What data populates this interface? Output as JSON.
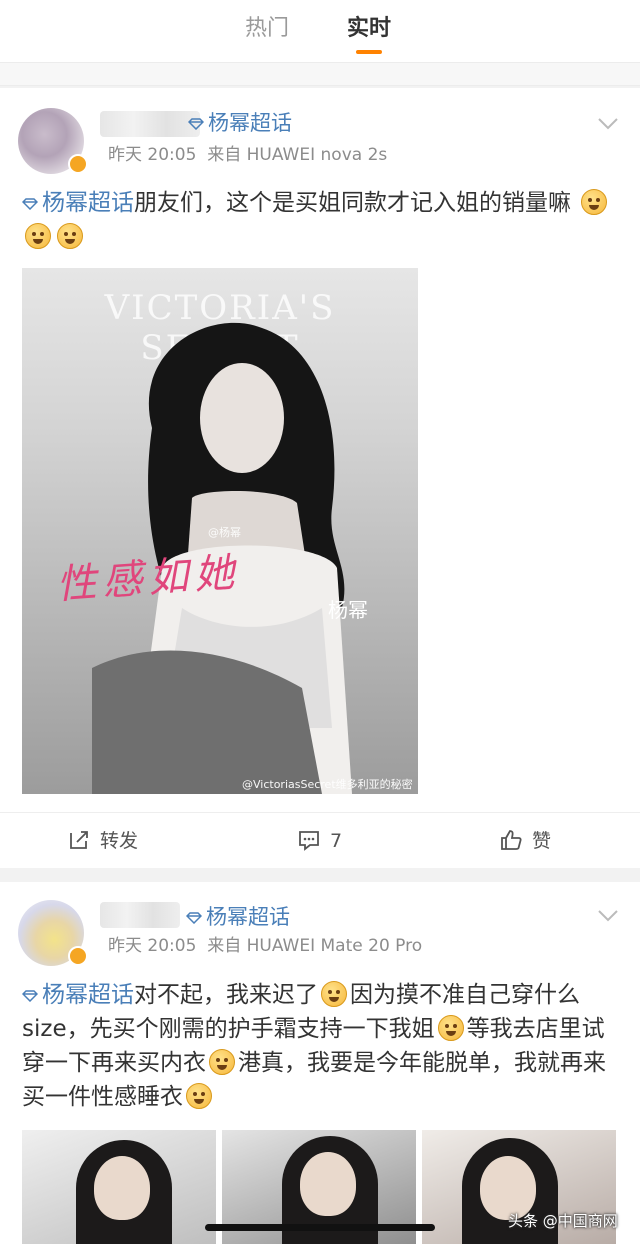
{
  "tabs": {
    "hot": "热门",
    "live": "实时",
    "active": "live"
  },
  "colors": {
    "accent": "#ff8200",
    "link": "#4a7fb8",
    "meta": "#8c8c8c",
    "signature": "#e0467c"
  },
  "posts": [
    {
      "topic_header": "杨幂超话",
      "time": "昨天 20:05",
      "source": "来自 HUAWEI nova 2s",
      "topic_inline": "杨幂超话",
      "text": "朋友们，这个是买姐同款才记入姐的销量嘛",
      "emoji": [
        "dizzy-face",
        "dizzy-face",
        "dizzy-face"
      ],
      "image": {
        "brand": "VICTORIA'S SECRET",
        "signature": "性感如她",
        "name": "杨幂",
        "watermark_top": "@杨幂",
        "watermark_bottom": "@VictoriasSecret维多利亚的秘密"
      },
      "actions": {
        "forward_label": "转发",
        "comment_count": "7",
        "like_label": "赞"
      }
    },
    {
      "topic_header": "杨幂超话",
      "time": "昨天 20:05",
      "source": "来自 HUAWEI Mate 20 Pro",
      "topic_inline": "杨幂超话",
      "segments": [
        "对不起，我来迟了",
        "因为摸不准自己穿什么size，先买个刚需的护手霜支持一下我姐",
        "等我去店里试穿一下再来买内衣",
        "港真，我要是今年能脱单，我就再来买一件性感睡衣"
      ],
      "emoji": [
        "laugh-cry",
        "grin",
        "grin",
        "grin"
      ]
    }
  ],
  "watermark": "头条 @中国商网"
}
